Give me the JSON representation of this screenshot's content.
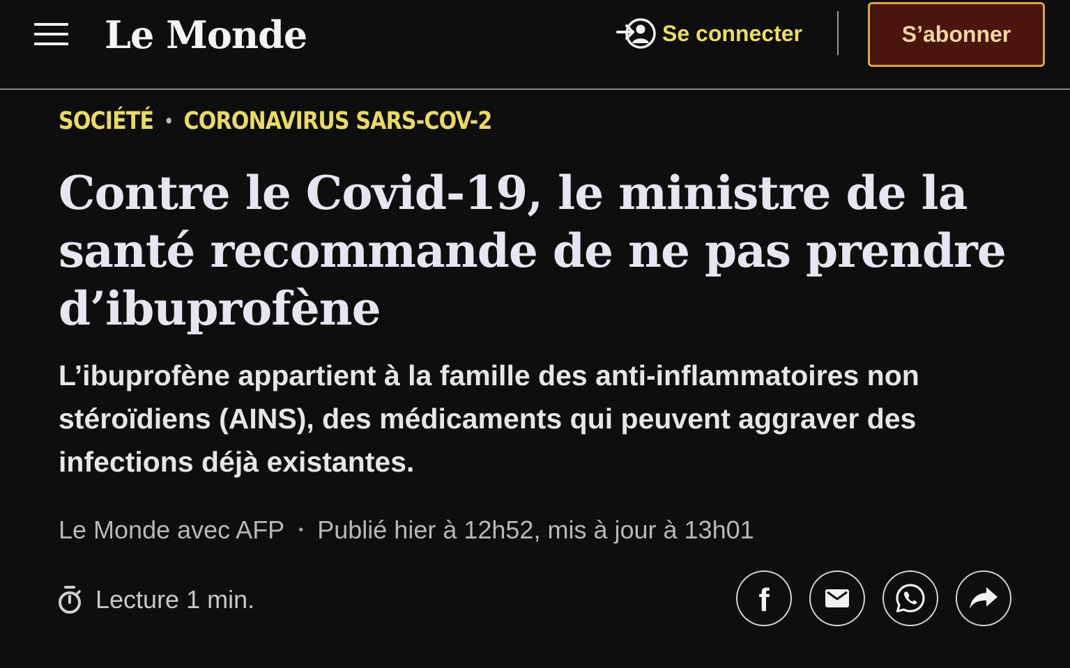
{
  "header": {
    "menu_icon": "hamburger-menu-icon",
    "logo_text": "Le Monde",
    "login_icon": "login-user-icon",
    "login_label": "Se connecter",
    "subscribe_label": "S’abonner"
  },
  "article": {
    "kicker": {
      "section": "SOCIÉTÉ",
      "separator": "•",
      "topic": "CORONAVIRUS SARS-COV-2"
    },
    "headline": "Contre le Covid-19, le ministre de la santé recommande de ne pas prendre d’ibuprofène",
    "dek": "L’ibuprofène appartient à la famille des anti-inflammatoires non stéroïdiens (AINS), des médicaments qui peuvent aggraver des infections déjà existantes.",
    "byline": {
      "author": "Le Monde avec AFP",
      "separator": "•",
      "date": "Publié hier à 12h52, mis à jour à 13h01"
    },
    "reading_time": {
      "icon": "stopwatch-icon",
      "label": "Lecture 1 min."
    },
    "share": [
      {
        "name": "facebook",
        "icon": "facebook-icon",
        "glyph": "f"
      },
      {
        "name": "email",
        "icon": "email-icon"
      },
      {
        "name": "whatsapp",
        "icon": "whatsapp-icon"
      },
      {
        "name": "share",
        "icon": "share-arrow-icon"
      }
    ]
  },
  "colors": {
    "background": "#0e0e0e",
    "accent_yellow": "#e9d96a",
    "subscribe_bg": "#4a150d",
    "subscribe_border": "#d8a64a",
    "text": "#e6e6e6",
    "muted_text": "#b8b8b8"
  }
}
